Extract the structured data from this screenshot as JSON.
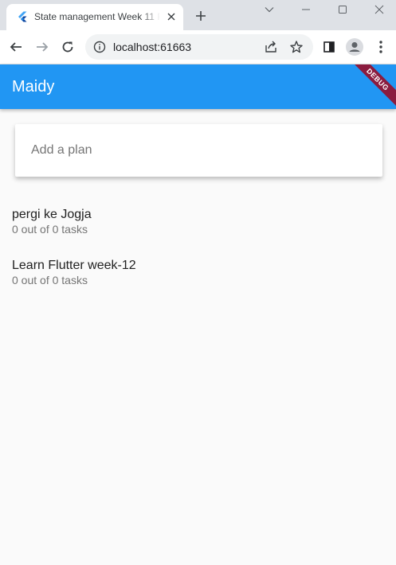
{
  "browser": {
    "tab": {
      "title": "State management Week 11 F",
      "favicon": "flutter-icon"
    },
    "url": "localhost:61663",
    "icons": [
      "back-icon",
      "forward-icon",
      "reload-icon",
      "info-icon",
      "share-icon",
      "star-icon",
      "sidepanel-icon",
      "profile-icon",
      "menu-icon",
      "new-tab-icon",
      "minimize-icon",
      "maximize-icon",
      "close-icon",
      "tab-search-icon"
    ]
  },
  "app": {
    "title": "Maidy",
    "debug_banner": "DEBUG",
    "input": {
      "placeholder": "Add a plan",
      "value": ""
    },
    "plans": [
      {
        "name": "pergi ke Jogja",
        "progress": "0 out of 0 tasks"
      },
      {
        "name": "Learn Flutter week-12",
        "progress": "0 out of 0 tasks"
      }
    ]
  },
  "colors": {
    "appbar": "#2196f3",
    "background": "#fafafa",
    "debug": "#8b1c3f"
  }
}
